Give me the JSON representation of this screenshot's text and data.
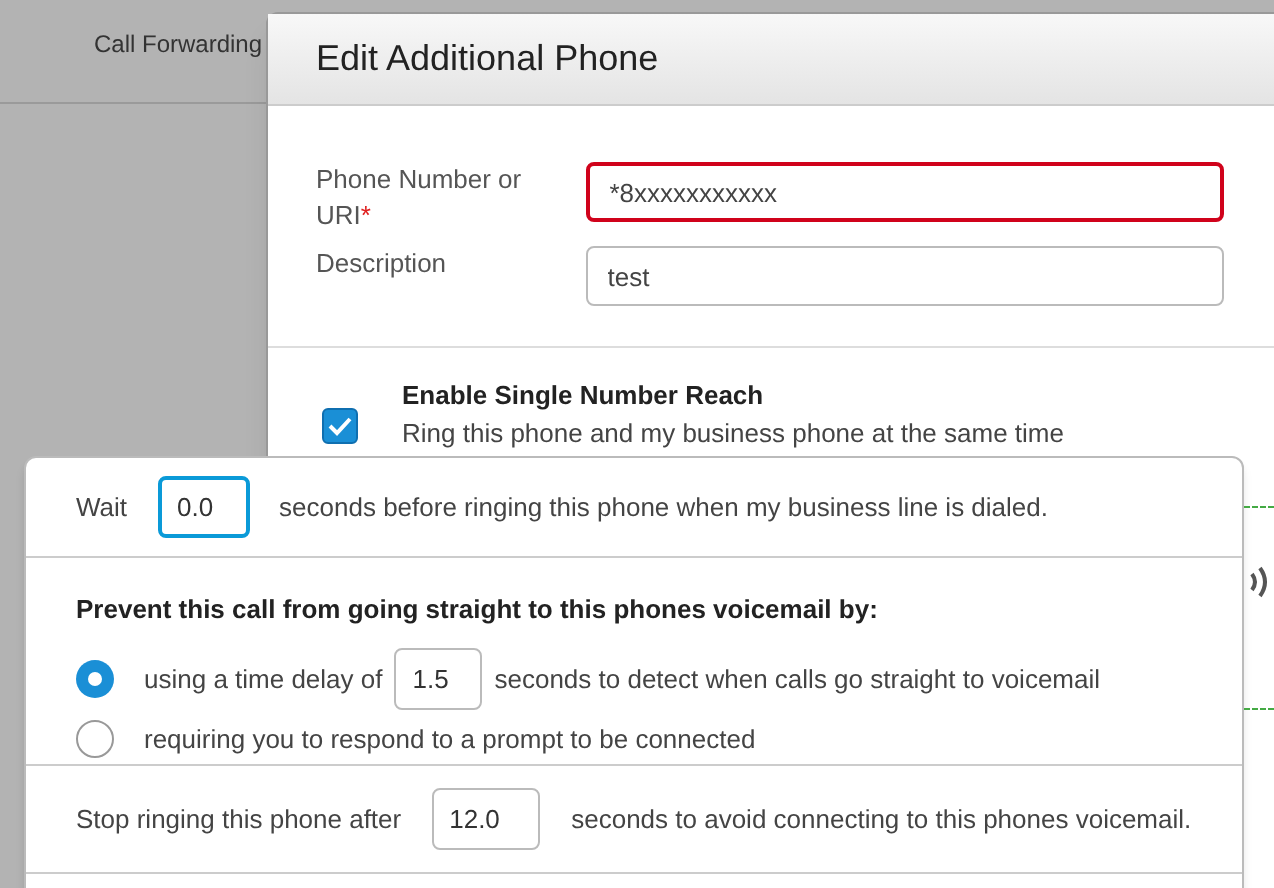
{
  "background": {
    "section_label": "Call Forwarding"
  },
  "dialog": {
    "title": "Edit Additional Phone",
    "fields": [
      {
        "label": "Phone Number or URI",
        "required_mark": "*",
        "value": "*8xxxxxxxxxxx",
        "invalid": true
      },
      {
        "label": "Description",
        "value": "test",
        "invalid": false
      }
    ],
    "single_number_reach": {
      "label": "Enable Single Number Reach",
      "description": "Ring this phone and my business phone at the same time",
      "checked": true
    }
  },
  "popover": {
    "wait": {
      "before": "Wait",
      "value": "0.0",
      "after": "seconds before ringing this phone when my business line is dialed.",
      "focused": true
    },
    "voicemail": {
      "heading": "Prevent this call from going straight to this phones voicemail by:",
      "options": [
        {
          "kind": "delay",
          "before": "using a time delay of",
          "value": "1.5",
          "after": "seconds to detect when calls go straight to voicemail",
          "selected": true
        },
        {
          "kind": "text",
          "label": "requiring you to respond to a prompt to be connected",
          "selected": false
        }
      ]
    },
    "stop": {
      "before": "Stop ringing this phone after",
      "value": "12.0",
      "after": "seconds to avoid connecting to this phones voicemail."
    }
  }
}
